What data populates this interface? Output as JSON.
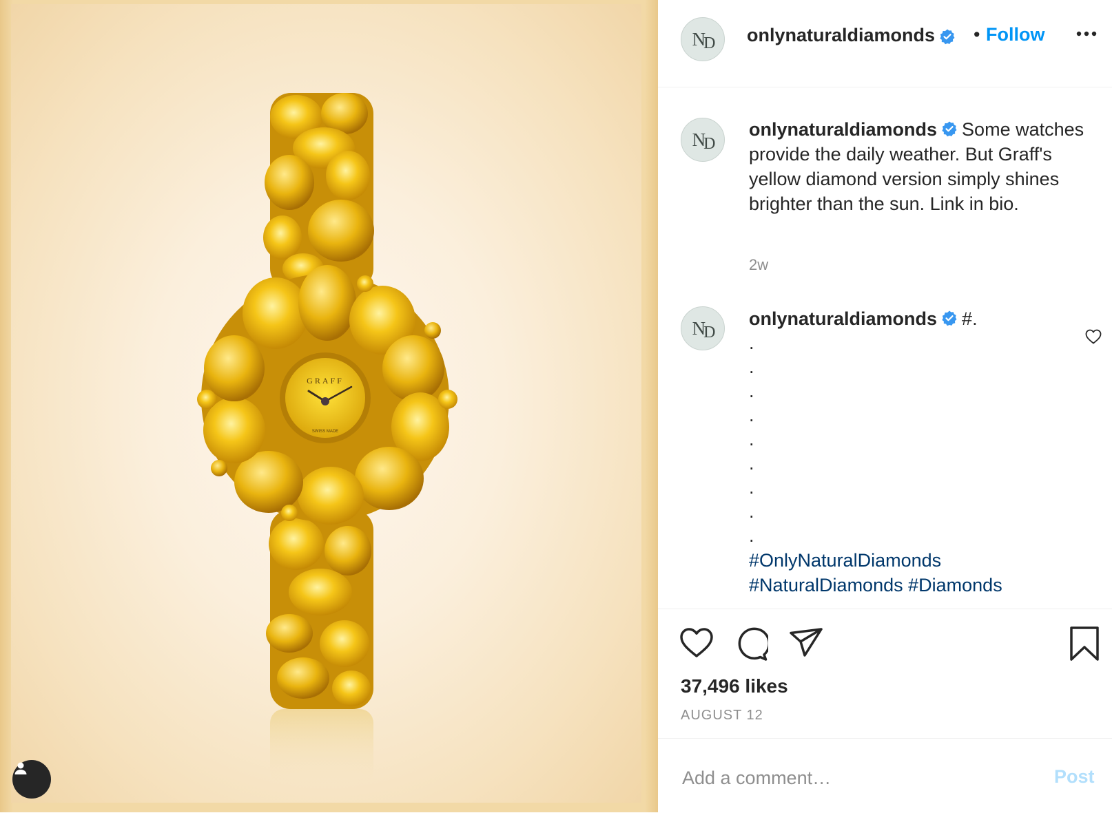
{
  "post": {
    "username": "onlynaturaldiamonds",
    "avatar_initials_n": "N",
    "avatar_initials_d": "D",
    "follow_label": "Follow",
    "bullet": "•",
    "watch_dial_brand": "GRAFF",
    "watch_dial_small": "SWISS MADE"
  },
  "comments": [
    {
      "username": "onlynaturaldiamonds",
      "text": "Some watches provide the daily weather. But Graff's yellow diamond version simply shines brighter than the sun. Link in bio.",
      "age": "2w"
    },
    {
      "username": "onlynaturaldiamonds",
      "text": "#.",
      "dots": [
        ".",
        ".",
        ".",
        ".",
        ".",
        ".",
        ".",
        ".",
        "."
      ],
      "hashtag_1": "#OnlyNaturalDiamonds",
      "hashtag_2": "#NaturalDiamonds",
      "hashtag_3": "#Diamonds"
    }
  ],
  "stats": {
    "likes": "37,496 likes",
    "date": "AUGUST 12"
  },
  "add_comment": {
    "placeholder": "Add a comment…",
    "post_label": "Post"
  },
  "icons": {
    "verified": "verified-badge-icon",
    "more": "more-options-icon",
    "like": "heart-icon",
    "comment": "comment-bubble-icon",
    "share": "paper-plane-icon",
    "save": "bookmark-icon",
    "user_tag": "person-icon"
  },
  "colors": {
    "link_blue": "#0095f6",
    "hashtag_blue": "#00376b",
    "verified_blue": "#3897f0",
    "muted_text": "#8e8e8e"
  }
}
